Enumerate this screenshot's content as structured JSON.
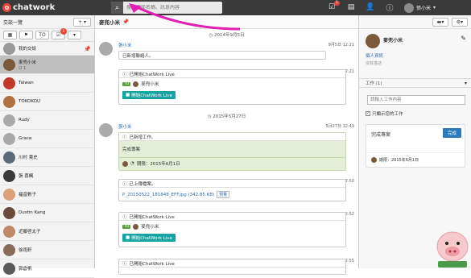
{
  "app": {
    "name": "chatwork"
  },
  "search": {
    "placeholder": "搜尋交談名稱、訊息內容"
  },
  "topbar": {
    "task_badge": "1",
    "user_name": "張小米"
  },
  "sidebar": {
    "title": "交談一覽",
    "add_label": "+",
    "filter_badge": "1",
    "rooms": [
      {
        "name": "我的交談",
        "sub": "",
        "active": false,
        "pinned": true,
        "color": "#9a9a9a"
      },
      {
        "name": "麥兜小米",
        "sub": "1",
        "active": true,
        "pinned": false,
        "color": "#7a5a3a"
      },
      {
        "name": "Taiwan",
        "sub": "",
        "active": false,
        "pinned": false,
        "color": "#c0392b"
      },
      {
        "name": "TOKOKOU",
        "sub": "",
        "active": false,
        "pinned": false,
        "color": "#b07040"
      },
      {
        "name": "Rudy",
        "sub": "",
        "active": false,
        "pinned": false,
        "color": "#a9a9a9"
      },
      {
        "name": "Grace",
        "sub": "",
        "active": false,
        "pinned": false,
        "color": "#a9a9a9"
      },
      {
        "name": "川村 貴史",
        "sub": "",
        "active": false,
        "pinned": false,
        "color": "#5a6a7a"
      },
      {
        "name": "張 喜楓",
        "sub": "",
        "active": false,
        "pinned": false,
        "color": "#3a3a3a"
      },
      {
        "name": "福音數子",
        "sub": "",
        "active": false,
        "pinned": false,
        "color": "#d9a07a"
      },
      {
        "name": "Dustin Kang",
        "sub": "",
        "active": false,
        "pinned": false,
        "color": "#6a4a3a"
      },
      {
        "name": "近藤啓太子",
        "sub": "",
        "active": false,
        "pinned": false,
        "color": "#c08a6a"
      },
      {
        "name": "徐雨軒",
        "sub": "",
        "active": false,
        "pinned": false,
        "color": "#8a6a5a"
      },
      {
        "name": "郭倉帆",
        "sub": "",
        "active": false,
        "pinned": false,
        "color": "#5a5a5a"
      }
    ]
  },
  "chat": {
    "room_title": "麥兜小米",
    "date1": "2014年9月5日",
    "date2": "2015年5月27日",
    "m1": {
      "sender": "張小米",
      "time": "9月5日 12:21",
      "text": "已新增聯絡人。"
    },
    "m2": {
      "time": "12:21",
      "title": "已開始ChatWork Live",
      "to": "TO",
      "to_name": "麥兜小米",
      "btn": "開始ChatWork Live"
    },
    "m3": {
      "sender": "張小米",
      "time": "5月27日 12:49",
      "title": "已新增工作。",
      "task_text": "完成專案",
      "due": "期限：2015年6月1日"
    },
    "m4": {
      "time": "12:50",
      "title": "已上傳檔案。",
      "file": "P_20150522_181848_EFF.jpg (342.85 KB)",
      "preview": "預覽"
    },
    "m5": {
      "time": "12:52",
      "title": "已開始ChatWork Live",
      "to": "TO",
      "to_name": "麥兜小米",
      "btn": "開始ChatWork Live"
    },
    "m6": {
      "time": "12:55",
      "title": "已開始ChatWork Live"
    }
  },
  "right": {
    "name": "麥兜小米",
    "profile_link": "個人資訊",
    "note": "沒有描述",
    "task_section": "工作 (1)",
    "task_placeholder": "請輸入工作內容",
    "show_done": "只顯示您的工作",
    "task_item": "完成專案",
    "complete_btn": "完成",
    "task_due": "期限：2015年6月1日"
  }
}
